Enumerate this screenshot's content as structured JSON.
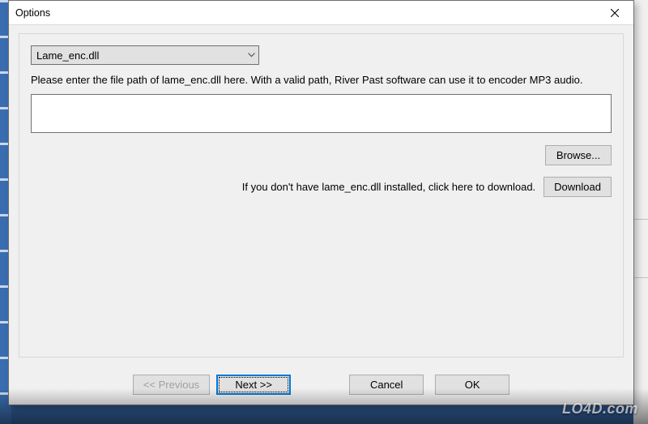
{
  "window": {
    "title": "Options"
  },
  "combo": {
    "selected": "Lame_enc.dll"
  },
  "instructions": {
    "text": "Please enter the file path of lame_enc.dll here. With a valid path, River Past software can use it to encoder MP3 audio."
  },
  "path_field": {
    "value": "",
    "placeholder": ""
  },
  "buttons": {
    "browse": "Browse...",
    "download": "Download",
    "previous": "<< Previous",
    "next": "Next >>",
    "cancel": "Cancel",
    "ok": "OK"
  },
  "download_hint": {
    "text": "If you don't have lame_enc.dll installed, click here to download."
  },
  "watermark": "LO4D.com"
}
